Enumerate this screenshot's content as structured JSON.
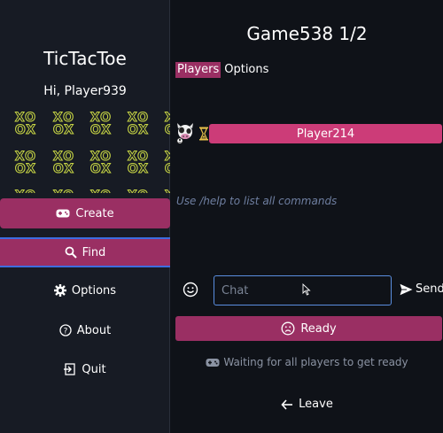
{
  "sidebar": {
    "title": "TicTacToe",
    "greeting": "Hi, Player939",
    "pattern_text": "XO OX",
    "buttons": {
      "create": "Create",
      "find": "Find",
      "options": "Options",
      "about": "About",
      "quit": "Quit"
    }
  },
  "main": {
    "title": "Game538 1/2",
    "tabs": [
      {
        "label": "Players",
        "active": true
      },
      {
        "label": "Options",
        "active": false
      }
    ],
    "players": [
      {
        "name": "Player214",
        "status_icon": "hourglass-icon"
      }
    ],
    "help_text": "Use /help to list all commands",
    "chat": {
      "placeholder": "Chat",
      "send_label": "Send"
    },
    "ready_label": "Ready",
    "waiting_text": "Waiting for all players to get ready",
    "leave_label": "Leave"
  },
  "colors": {
    "accent": "#9a2f63",
    "player_bar": "#cc3c78",
    "pattern": "#c8d645",
    "focus_border": "#5a8ee0",
    "background": "#0f1218",
    "sidebar_bg": "#171b24"
  }
}
